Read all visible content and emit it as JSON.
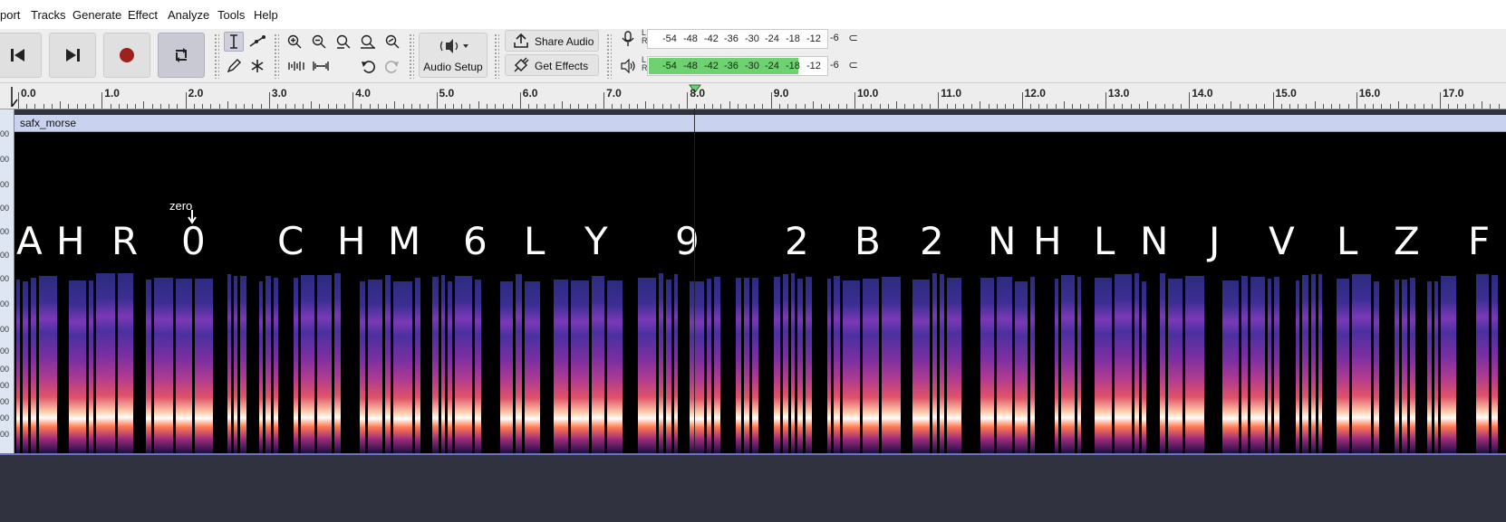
{
  "menu": [
    "port",
    "Tracks",
    "Generate",
    "Effect",
    "Analyze",
    "Tools",
    "Help"
  ],
  "toolbar": {
    "audio_setup": "Audio Setup",
    "share_audio": "Share Audio",
    "get_effects": "Get Effects"
  },
  "meter": {
    "scale": [
      "-54",
      "-48",
      "-42",
      "-36",
      "-30",
      "-24",
      "-18",
      "-12",
      "-6"
    ],
    "channels": [
      "L",
      "R"
    ],
    "playback_level_db": -10
  },
  "ruler": {
    "labels": [
      "0.0",
      "1.0",
      "2.0",
      "3.0",
      "4.0",
      "5.0",
      "6.0",
      "7.0",
      "8.0",
      "9.0",
      "10.0",
      "11.0",
      "12.0",
      "13.0",
      "14.0",
      "15.0",
      "16.0",
      "17.0"
    ]
  },
  "track": {
    "clip_name": "safx_morse"
  },
  "annotation": {
    "letters": [
      "A",
      "H",
      "R",
      "0",
      "C",
      "H",
      "M",
      "6",
      "L",
      "Y",
      "9",
      "2",
      "B",
      "2",
      "N",
      "H",
      "L",
      "N",
      "J",
      "V",
      "L",
      "Z",
      "F"
    ],
    "note": "zero"
  },
  "colors": {
    "meter_fill": "#6dd26f",
    "clip_header": "#c9d3f0",
    "background": "#30323f"
  }
}
